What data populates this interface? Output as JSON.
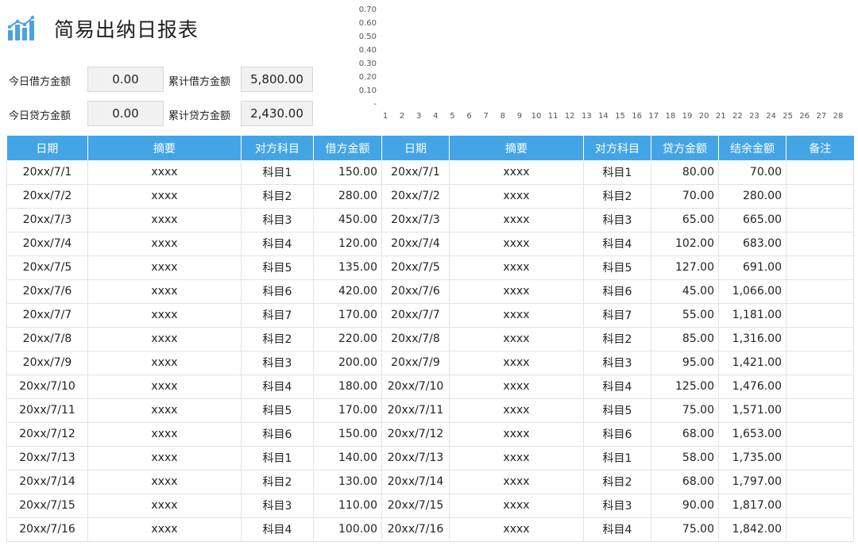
{
  "header": {
    "title": "简易出纳日报表"
  },
  "summary": {
    "today_debit_label": "今日借方金额",
    "today_debit_value": "0.00",
    "total_debit_label": "累计借方金额",
    "total_debit_value": "5,800.00",
    "today_credit_label": "今日贷方金额",
    "today_credit_value": "0.00",
    "total_credit_label": "累计贷方金额",
    "total_credit_value": "2,430.00"
  },
  "chart_data": {
    "type": "bar",
    "title": "",
    "xlabel": "",
    "ylabel": "",
    "ylim": [
      0,
      0.7
    ],
    "yticks": [
      "0.70",
      "0.60",
      "0.50",
      "0.40",
      "0.30",
      "0.20",
      "0.10",
      "-"
    ],
    "categories": [
      "1",
      "2",
      "3",
      "4",
      "5",
      "6",
      "7",
      "8",
      "9",
      "10",
      "11",
      "12",
      "13",
      "14",
      "15",
      "16",
      "17",
      "18",
      "19",
      "20",
      "21",
      "22",
      "23",
      "24",
      "25",
      "26",
      "27",
      "28"
    ],
    "values": [
      0,
      0,
      0,
      0,
      0,
      0,
      0,
      0,
      0,
      0,
      0,
      0,
      0,
      0,
      0,
      0,
      0,
      0,
      0,
      0,
      0,
      0,
      0,
      0,
      0,
      0,
      0,
      0
    ],
    "grid": false,
    "legend": "none"
  },
  "table": {
    "headers": [
      "日期",
      "摘要",
      "对方科目",
      "借方金额",
      "日期",
      "摘要",
      "对方科目",
      "贷方金额",
      "结余金额",
      "备注"
    ],
    "rows": [
      [
        "20xx/7/1",
        "xxxx",
        "科目1",
        "150.00",
        "20xx/7/1",
        "xxxx",
        "科目1",
        "80.00",
        "70.00",
        ""
      ],
      [
        "20xx/7/2",
        "xxxx",
        "科目2",
        "280.00",
        "20xx/7/2",
        "xxxx",
        "科目2",
        "70.00",
        "280.00",
        ""
      ],
      [
        "20xx/7/3",
        "xxxx",
        "科目3",
        "450.00",
        "20xx/7/3",
        "xxxx",
        "科目3",
        "65.00",
        "665.00",
        ""
      ],
      [
        "20xx/7/4",
        "xxxx",
        "科目4",
        "120.00",
        "20xx/7/4",
        "xxxx",
        "科目4",
        "102.00",
        "683.00",
        ""
      ],
      [
        "20xx/7/5",
        "xxxx",
        "科目5",
        "135.00",
        "20xx/7/5",
        "xxxx",
        "科目5",
        "127.00",
        "691.00",
        ""
      ],
      [
        "20xx/7/6",
        "xxxx",
        "科目6",
        "420.00",
        "20xx/7/6",
        "xxxx",
        "科目6",
        "45.00",
        "1,066.00",
        ""
      ],
      [
        "20xx/7/7",
        "xxxx",
        "科目7",
        "170.00",
        "20xx/7/7",
        "xxxx",
        "科目7",
        "55.00",
        "1,181.00",
        ""
      ],
      [
        "20xx/7/8",
        "xxxx",
        "科目2",
        "220.00",
        "20xx/7/8",
        "xxxx",
        "科目2",
        "85.00",
        "1,316.00",
        ""
      ],
      [
        "20xx/7/9",
        "xxxx",
        "科目3",
        "200.00",
        "20xx/7/9",
        "xxxx",
        "科目3",
        "95.00",
        "1,421.00",
        ""
      ],
      [
        "20xx/7/10",
        "xxxx",
        "科目4",
        "180.00",
        "20xx/7/10",
        "xxxx",
        "科目4",
        "125.00",
        "1,476.00",
        ""
      ],
      [
        "20xx/7/11",
        "xxxx",
        "科目5",
        "170.00",
        "20xx/7/11",
        "xxxx",
        "科目5",
        "75.00",
        "1,571.00",
        ""
      ],
      [
        "20xx/7/12",
        "xxxx",
        "科目6",
        "150.00",
        "20xx/7/12",
        "xxxx",
        "科目6",
        "68.00",
        "1,653.00",
        ""
      ],
      [
        "20xx/7/13",
        "xxxx",
        "科目1",
        "140.00",
        "20xx/7/13",
        "xxxx",
        "科目1",
        "58.00",
        "1,735.00",
        ""
      ],
      [
        "20xx/7/14",
        "xxxx",
        "科目2",
        "130.00",
        "20xx/7/14",
        "xxxx",
        "科目2",
        "68.00",
        "1,797.00",
        ""
      ],
      [
        "20xx/7/15",
        "xxxx",
        "科目3",
        "110.00",
        "20xx/7/15",
        "xxxx",
        "科目3",
        "90.00",
        "1,817.00",
        ""
      ],
      [
        "20xx/7/16",
        "xxxx",
        "科目4",
        "100.00",
        "20xx/7/16",
        "xxxx",
        "科目4",
        "75.00",
        "1,842.00",
        ""
      ]
    ]
  }
}
